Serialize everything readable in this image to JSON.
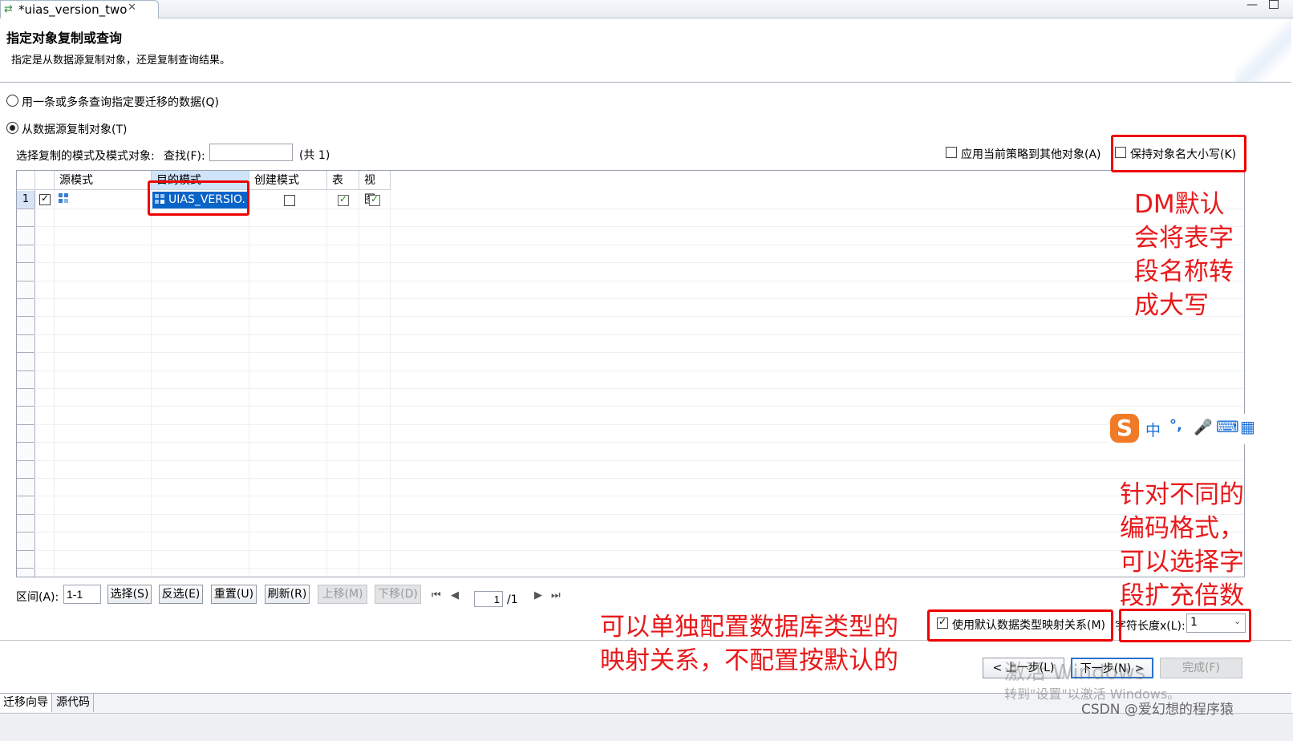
{
  "tab": {
    "title": "*uias_version_two",
    "close": "✕"
  },
  "header": {
    "title": "指定对象复制或查询",
    "description": "指定是从数据源复制对象，还是复制查询结果。"
  },
  "options": {
    "query_option": "用一条或多条查询指定要迁移的数据(Q)",
    "copy_option": "从数据源复制对象(T)"
  },
  "filter": {
    "select_label": "选择复制的模式及模式对象:",
    "find_label": "查找(F):",
    "find_value": "",
    "count": "(共 1)",
    "apply_strategy": "应用当前策略到其他对象(A)",
    "keep_case": "保持对象名大小写(K)"
  },
  "table": {
    "columns": [
      "源模式",
      "目的模式",
      "创建模式",
      "表",
      "视图."
    ],
    "rows": [
      {
        "index": "1",
        "checked": true,
        "source": "",
        "target": "UIAS_VERSIO.",
        "create_schema": false,
        "table": true,
        "view": true
      }
    ]
  },
  "toolbar": {
    "range_label": "区间(A):",
    "range_value": "1-1",
    "select": "选择(S)",
    "invert": "反选(E)",
    "reset": "重置(U)",
    "refresh": "刷新(R)",
    "move_up": "上移(M)",
    "move_down": "下移(D)",
    "page_value": "1",
    "page_total": "/1"
  },
  "mapping": {
    "default_mapping": "使用默认数据类型映射关系(M)",
    "char_len_label": "字符长度x(L):",
    "char_len_value": "1"
  },
  "wizard": {
    "prev": "< 上一步(L)",
    "next": "下一步(N) >",
    "finish": "完成(F)"
  },
  "watermark": {
    "activate_title": "激活 Windows",
    "activate_sub": "转到\"设置\"以激活 Windows。",
    "csdn": "CSDN @爱幻想的程序猿"
  },
  "bottom_tabs": [
    "迁移向导",
    "源代码"
  ],
  "ime": {
    "logo": "S",
    "lang": "中",
    "punct": "°,",
    "mic": "🎤",
    "keyboard": "⌨",
    "grid": "▦"
  },
  "annotations": {
    "uppercase_note": [
      "DM默认",
      "会将表字",
      "段名称转",
      "成大写"
    ],
    "encoding_note": [
      "针对不同的",
      "编码格式，",
      "可以选择字",
      "段扩充倍数"
    ],
    "mapping_note": [
      "可以单独配置数据库类型的",
      "映射关系，不配置按默认的"
    ]
  },
  "colors": {
    "annotation_red": "#e8191b",
    "selection_blue": "#0a64c8",
    "header_blue": "#cfe3fb"
  }
}
